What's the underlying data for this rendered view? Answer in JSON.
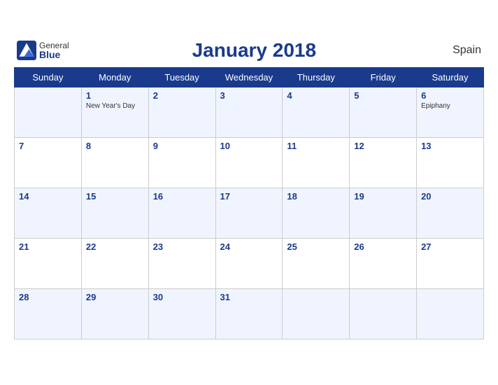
{
  "header": {
    "logo_general": "General",
    "logo_blue": "Blue",
    "title": "January 2018",
    "country": "Spain"
  },
  "days_of_week": [
    "Sunday",
    "Monday",
    "Tuesday",
    "Wednesday",
    "Thursday",
    "Friday",
    "Saturday"
  ],
  "weeks": [
    [
      {
        "date": "",
        "holiday": ""
      },
      {
        "date": "1",
        "holiday": "New Year's Day"
      },
      {
        "date": "2",
        "holiday": ""
      },
      {
        "date": "3",
        "holiday": ""
      },
      {
        "date": "4",
        "holiday": ""
      },
      {
        "date": "5",
        "holiday": ""
      },
      {
        "date": "6",
        "holiday": "Epiphany"
      }
    ],
    [
      {
        "date": "7",
        "holiday": ""
      },
      {
        "date": "8",
        "holiday": ""
      },
      {
        "date": "9",
        "holiday": ""
      },
      {
        "date": "10",
        "holiday": ""
      },
      {
        "date": "11",
        "holiday": ""
      },
      {
        "date": "12",
        "holiday": ""
      },
      {
        "date": "13",
        "holiday": ""
      }
    ],
    [
      {
        "date": "14",
        "holiday": ""
      },
      {
        "date": "15",
        "holiday": ""
      },
      {
        "date": "16",
        "holiday": ""
      },
      {
        "date": "17",
        "holiday": ""
      },
      {
        "date": "18",
        "holiday": ""
      },
      {
        "date": "19",
        "holiday": ""
      },
      {
        "date": "20",
        "holiday": ""
      }
    ],
    [
      {
        "date": "21",
        "holiday": ""
      },
      {
        "date": "22",
        "holiday": ""
      },
      {
        "date": "23",
        "holiday": ""
      },
      {
        "date": "24",
        "holiday": ""
      },
      {
        "date": "25",
        "holiday": ""
      },
      {
        "date": "26",
        "holiday": ""
      },
      {
        "date": "27",
        "holiday": ""
      }
    ],
    [
      {
        "date": "28",
        "holiday": ""
      },
      {
        "date": "29",
        "holiday": ""
      },
      {
        "date": "30",
        "holiday": ""
      },
      {
        "date": "31",
        "holiday": ""
      },
      {
        "date": "",
        "holiday": ""
      },
      {
        "date": "",
        "holiday": ""
      },
      {
        "date": "",
        "holiday": ""
      }
    ]
  ]
}
